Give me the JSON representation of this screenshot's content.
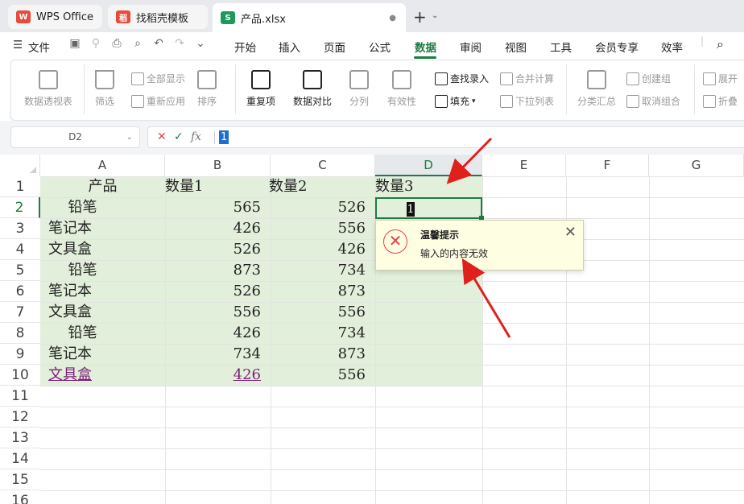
{
  "tabs": [
    {
      "label": "WPS Office",
      "logo": "W",
      "color": "#e84b3c"
    },
    {
      "label": "找稻壳模板",
      "logo": "稻",
      "color": "#e84b3c"
    },
    {
      "label": "产品.xlsx",
      "logo": "S",
      "color": "#1d9a5a"
    }
  ],
  "menubar": {
    "file": "文件",
    "items": [
      "开始",
      "插入",
      "页面",
      "公式",
      "数据",
      "审阅",
      "视图",
      "工具",
      "会员专享",
      "效率"
    ],
    "active": "数据"
  },
  "ribbon": {
    "pivot": "数据透视表",
    "filter": "筛选",
    "show_all": "全部显示",
    "reapply": "重新应用",
    "sort": "排序",
    "duplicates": "重复项",
    "compare": "数据对比",
    "split": "分列",
    "validity": "有效性",
    "find_entry": "查找录入",
    "fill": "填充",
    "consolidate": "合并计算",
    "dropdown_list": "下拉列表",
    "subtotal": "分类汇总",
    "create_group": "创建组",
    "ungroup": "取消组合",
    "expand": "展开",
    "collapse": "折叠"
  },
  "formula_bar": {
    "name_box": "D2",
    "fx": "fx",
    "value": "1"
  },
  "columns": [
    "A",
    "B",
    "C",
    "D",
    "E",
    "F",
    "G"
  ],
  "rows": [
    "1",
    "2",
    "3",
    "4",
    "5",
    "6",
    "7",
    "8",
    "9",
    "10",
    "11",
    "12",
    "13",
    "14",
    "15",
    "16"
  ],
  "table": {
    "headers": [
      "产品",
      "数量1",
      "数量2",
      "数量3"
    ],
    "data": [
      [
        "铅笔",
        "565",
        "526"
      ],
      [
        "笔记本",
        "426",
        "556"
      ],
      [
        "文具盒",
        "526",
        "426"
      ],
      [
        "铅笔",
        "873",
        "734"
      ],
      [
        "笔记本",
        "526",
        "873"
      ],
      [
        "文具盒",
        "556",
        "556"
      ],
      [
        "铅笔",
        "426",
        "734"
      ],
      [
        "笔记本",
        "734",
        "873"
      ],
      [
        "文具盒",
        "426",
        "556"
      ]
    ]
  },
  "active_cell_value": "1",
  "tooltip": {
    "title": "温馨提示",
    "message": "输入的内容无效",
    "icon": "error-x-icon"
  },
  "colors": {
    "accent": "#1f7a45",
    "table_fill": "#e2efda",
    "error": "#e5404a",
    "annotation": "#e0201c"
  }
}
